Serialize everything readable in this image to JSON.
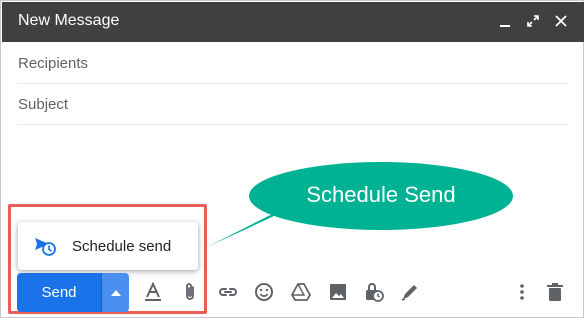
{
  "window": {
    "title": "New Message"
  },
  "titlebar_icons": [
    "minimize-icon",
    "expand-icon",
    "close-icon"
  ],
  "fields": {
    "recipients_placeholder": "Recipients",
    "subject_placeholder": "Subject"
  },
  "schedule_menu": {
    "label": "Schedule send",
    "icon": "schedule-send-icon"
  },
  "send_button": {
    "label": "Send"
  },
  "toolbar_icons": [
    "formatting-icon",
    "attach-icon",
    "link-icon",
    "emoji-icon",
    "drive-icon",
    "photo-icon",
    "confidential-icon",
    "signature-icon",
    "more-options-icon",
    "trash-icon"
  ],
  "callout": {
    "text": "Schedule Send"
  },
  "colors": {
    "titlebar": "#404040",
    "send": "#1a73e8",
    "callout": "#00b294",
    "highlight": "#e95e57"
  }
}
